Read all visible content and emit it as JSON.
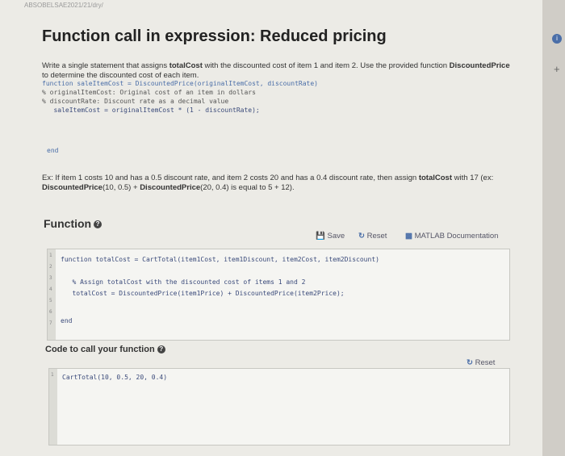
{
  "topnote": "ABSOBELSAE2021/21/dry/",
  "title": "Function call in expression: Reduced pricing",
  "description": {
    "part1": "Write a single statement that assigns ",
    "bold1": "totalCost",
    "part2": " with the discounted cost of item 1 and item 2. Use the provided function ",
    "bold2": "DiscountedPrice",
    "part3": " to determine the discounted cost of each item."
  },
  "provided_code": [
    "function saleItemCost = DiscountedPrice(originalItemCost, discountRate)",
    "% originalItemCost: Original cost of an item in dollars",
    "% discountRate: Discount rate as a decimal value",
    "",
    "   saleItemCost = originalItemCost * (1 - discountRate);"
  ],
  "provided_end": "end",
  "example": {
    "part1": "Ex: If item 1 costs 10 and has a 0.5 discount rate, and item 2 costs 20 and has a 0.4 discount rate, then assign ",
    "bold1": "totalCost",
    "part2": " with 17 (ex: ",
    "bold2": "DiscountedPrice",
    "part3": "(10, 0.5) + ",
    "bold3": "DiscountedPrice",
    "part4": "(20, 0.4) is equal to 5 + 12)."
  },
  "function_heading": "Function",
  "toolbar": {
    "save": "Save",
    "reset": "Reset",
    "docs": "MATLAB Documentation"
  },
  "editor_lines": [
    "function totalCost = CartTotal(item1Cost, item1Discount, item2Cost, item2Discount)",
    "",
    "   % Assign totalCost with the discounted cost of items 1 and 2",
    "   totalCost = DiscountedPrice(item1Price) + DiscountedPrice(item2Price);",
    "",
    "",
    "end"
  ],
  "editor_line_numbers": [
    "1",
    "2",
    "3",
    "4",
    "5",
    "6",
    "7"
  ],
  "call_heading": "Code to call your function",
  "call_reset": "Reset",
  "call_line_number": "1",
  "call_line": "CartTotal(10, 0.5, 20, 0.4)"
}
